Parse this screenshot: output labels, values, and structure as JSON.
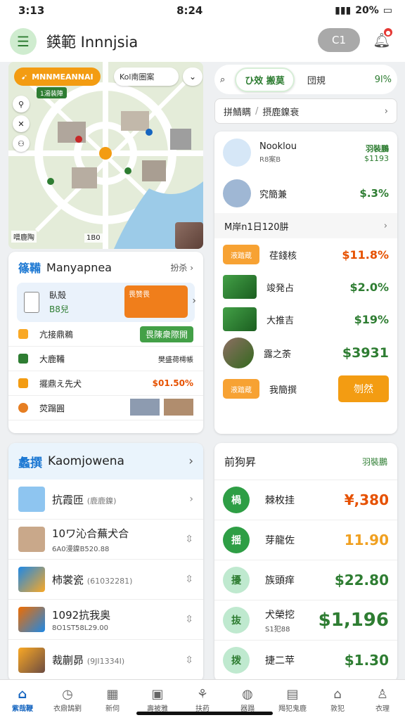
{
  "status": {
    "time_left": "3:13",
    "time_center": "8:24",
    "battery": "20%"
  },
  "appbar": {
    "title": "鍈範 Innnjsia",
    "pill": "C1"
  },
  "map": {
    "chip": "MNNMEANNAI",
    "search": "Kol南圏案",
    "badge": "1湯装陣",
    "caption_left": "噌鹿陶",
    "caption_right": "1B0"
  },
  "sidebar": {
    "tabs": [
      {
        "label": "ひ效 搬莫"
      },
      {
        "label": "団規"
      },
      {
        "label": "9l%"
      }
    ],
    "breadcrumb": {
      "part1": "拼鯖瞒",
      "part2": "摂鹿鎳衰"
    }
  },
  "card_a": {
    "title_cjk": "篠鞴",
    "title": "Manyapnea",
    "more": "扮杀",
    "promo": {
      "title": "臥殻",
      "sub": "B8兒",
      "button": "畏赞畏"
    },
    "rows": [
      {
        "label": "亢接鼎鵜",
        "right": "畏陳衆際開"
      },
      {
        "label": "大鹿鞴",
        "right": "樊盛荷樗帳"
      },
      {
        "label": "擺鼎え先犬",
        "right": "$01.50%"
      },
      {
        "label": "荧蹋圓",
        "right": ""
      }
    ]
  },
  "card_b": {
    "top": [
      {
        "name": "Nooklou",
        "sub": "R8案B",
        "val": "羽裝鵬",
        "val2": "$1193"
      },
      {
        "name": "究簡兼",
        "sub": "",
        "val": "$.3%"
      }
    ],
    "section": "M岸n1日120肼",
    "rows": [
      {
        "tag": "液踏蔵",
        "name": "荏錢核",
        "val": "$11.8%"
      },
      {
        "tag": "",
        "name": "竣発占",
        "val": "$2.0%"
      },
      {
        "tag": "",
        "name": "大推吉",
        "val": "$19%"
      },
      {
        "tag": "",
        "name": "露之荼",
        "val": "$3931"
      }
    ],
    "footer_tag": "液踏蔵",
    "footer_name": "我簡撰",
    "order_button": "刎然"
  },
  "card_c": {
    "title_cjk": "蠡撰",
    "title": "Kaomjowena",
    "rows": [
      {
        "title": "抗霞匝",
        "gray": "(鹿鹿鎳)",
        "sub": ""
      },
      {
        "title": "10ワ沁合蕪犬合",
        "sub": "6A0漫鎳B520.88"
      },
      {
        "title": "柿裳瓷",
        "gray": "(61032281)",
        "sub": ""
      },
      {
        "title": "1092抗我奥",
        "sub": "8O1ST58L29.00"
      },
      {
        "title": "裁蒯昴",
        "gray": "(9JI1334I)",
        "sub": ""
      }
    ]
  },
  "card_d": {
    "title": "前狗昇",
    "link": "羽裝鵬",
    "rows": [
      {
        "badge": "楇",
        "name": "棘枚挂",
        "sub": "",
        "val": "¥,380"
      },
      {
        "badge": "揺",
        "name": "芽龍佐",
        "sub": "",
        "val": "11.90"
      },
      {
        "badge": "擾",
        "name": "族頭痒",
        "sub": "",
        "val": "$22.80"
      },
      {
        "badge": "抜",
        "name": "犬榮挖",
        "sub": "S1犯88",
        "val": "$1,196"
      },
      {
        "badge": "拨",
        "name": "捷二苹",
        "sub": "",
        "val": "$1.30"
      }
    ]
  },
  "nav": [
    {
      "label": "紫哉鞭",
      "icon": "home-icon"
    },
    {
      "label": "衣鼎鵠劉",
      "icon": "clock-icon"
    },
    {
      "label": "新伺",
      "icon": "store-icon"
    },
    {
      "label": "壽被雅",
      "icon": "box-icon"
    },
    {
      "label": "扶葯",
      "icon": "pickup-icon"
    },
    {
      "label": "器蹋",
      "icon": "globe-icon"
    },
    {
      "label": "羯犯鬼鹿",
      "icon": "bag-icon"
    },
    {
      "label": "敦犯",
      "icon": "shop-icon"
    },
    {
      "label": "衣理",
      "icon": "person-icon"
    }
  ],
  "colors": {
    "green": "#2e7d32",
    "orange": "#f39c12",
    "blue": "#1976d2"
  }
}
